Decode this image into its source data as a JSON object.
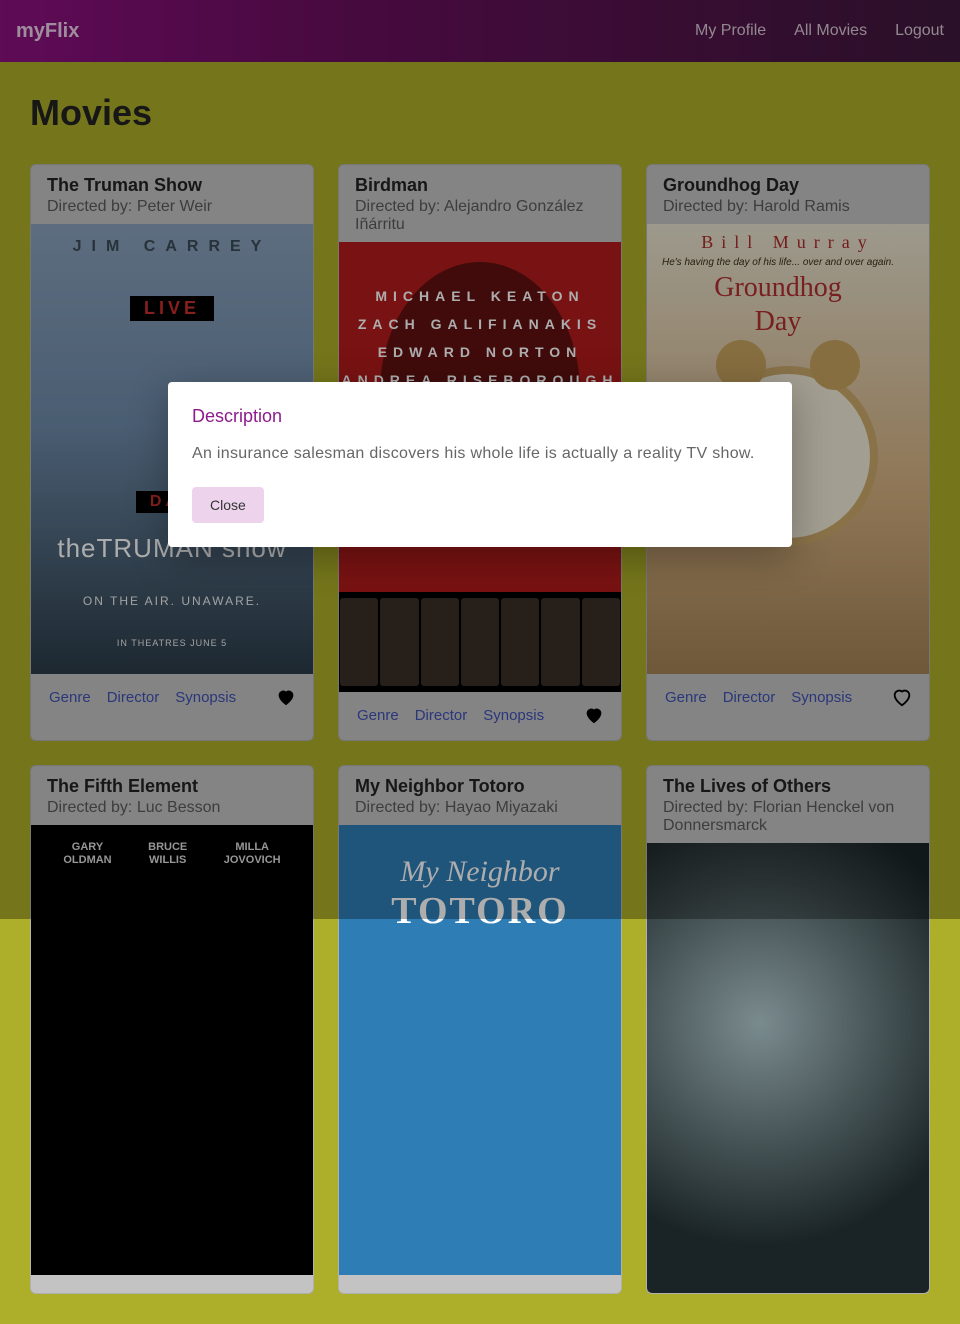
{
  "nav": {
    "brand": "myFlix",
    "links": [
      "My Profile",
      "All Movies",
      "Logout"
    ]
  },
  "page_title": "Movies",
  "card_links": {
    "genre": "Genre",
    "director": "Director",
    "synopsis": "Synopsis"
  },
  "movies": [
    {
      "title": "The Truman Show",
      "directed_by": "Directed by: Peter Weir",
      "favorite": true,
      "poster": {
        "top": "JIM CARREY",
        "live": "LIVE",
        "day": "DAY",
        "logo": "theTRUMAN show",
        "tag": "ON THE AIR. UNAWARE.",
        "date": "IN THEATRES JUNE 5"
      }
    },
    {
      "title": "Birdman",
      "directed_by": "Directed by: Alejandro González Iñárritu",
      "favorite": true,
      "poster": {
        "names": "MICHAEL KEATON\nZACH GALIFIANAKIS\nEDWARD NORTON\nANDREA RISEBOROUGH\nAMY RYAN"
      }
    },
    {
      "title": "Groundhog Day",
      "directed_by": "Directed by: Harold Ramis",
      "favorite": false,
      "poster": {
        "bill": "Bill Murray",
        "tag": "He's having the day of his life... over and over again.",
        "gtitle1": "Groundhog",
        "gtitle2": "Day"
      }
    },
    {
      "title": "The Fifth Element",
      "directed_by": "Directed by: Luc Besson",
      "favorite": false,
      "poster": {
        "n1a": "GARY",
        "n1b": "OLDMAN",
        "n2a": "BRUCE",
        "n2b": "WILLIS",
        "n3a": "MILLA",
        "n3b": "JOVOVICH"
      }
    },
    {
      "title": "My Neighbor Totoro",
      "directed_by": "Directed by: Hayao Miyazaki",
      "favorite": false,
      "poster": {
        "l1": "My Neighbor",
        "l2": "TOTORO"
      }
    },
    {
      "title": "The Lives of Others",
      "directed_by": "Directed by: Florian Henckel von Donnersmarck",
      "favorite": false,
      "poster": {}
    }
  ],
  "dialog": {
    "title": "Description",
    "body": "An insurance salesman discovers his whole life is actually a reality TV show.",
    "close": "Close"
  }
}
